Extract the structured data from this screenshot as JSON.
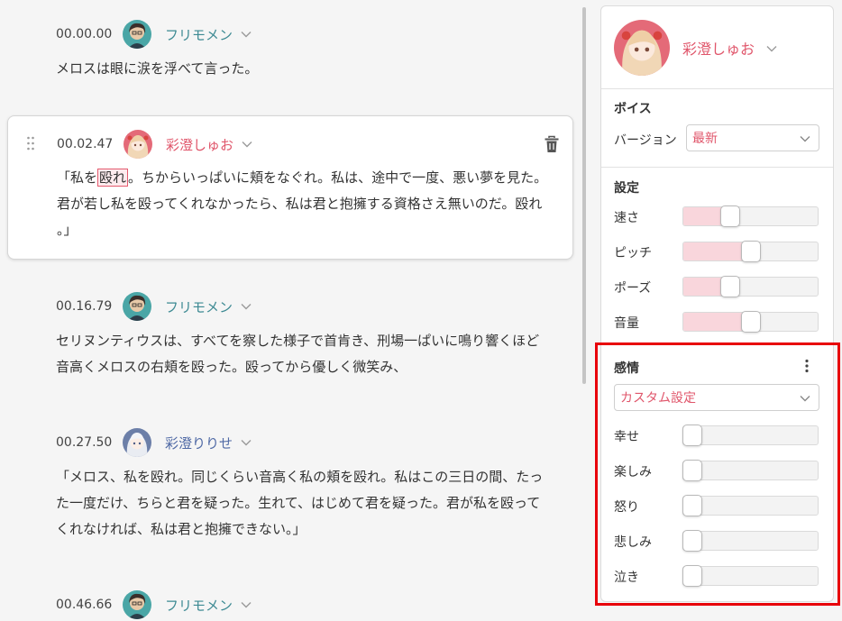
{
  "script": {
    "entries": [
      {
        "time": "00.00.00",
        "speaker": "フリモメン",
        "color": "teal",
        "lines": [
          "メロスは眼に涙を浮べて言った。"
        ]
      },
      {
        "time": "00.02.47",
        "speaker": "彩澄しゅお",
        "color": "pink",
        "selected": true,
        "line1_before": "「私を",
        "line1_highlight": "殴れ",
        "line1_after": "。ちからいっぱいに頬をなぐれ。私は、途中で一度、悪い夢を見た。",
        "line2": "君が若し私を殴ってくれなかったら、私は君と抱擁する資格さえ無いのだ。殴れ",
        "line3": "。」"
      },
      {
        "time": "00.16.79",
        "speaker": "フリモメン",
        "color": "teal",
        "lines": [
          "セリヌンティウスは、すべてを察した様子で首肯き、刑場一ぱいに鳴り響くほど",
          "音高くメロスの右頬を殴った。殴ってから優しく微笑み、"
        ]
      },
      {
        "time": "00.27.50",
        "speaker": "彩澄りりせ",
        "color": "blue",
        "lines": [
          "「メロス、私を殴れ。同じくらい音高く私の頬を殴れ。私はこの三日の間、たっ",
          "た一度だけ、ちらと君を疑った。生れて、はじめて君を疑った。君が私を殴って",
          "くれなければ、私は君と抱擁できない。」"
        ]
      },
      {
        "time": "00.46.66",
        "speaker": "フリモメン",
        "color": "teal",
        "lines": []
      }
    ]
  },
  "panel": {
    "character": "彩澄しゅお",
    "voice": {
      "title": "ボイス",
      "version_label": "バージョン",
      "version_value": "最新"
    },
    "settings": {
      "title": "設定",
      "sliders": [
        {
          "label": "速さ",
          "value": 0.35
        },
        {
          "label": "ピッチ",
          "value": 0.5
        },
        {
          "label": "ポーズ",
          "value": 0.35
        },
        {
          "label": "音量",
          "value": 0.5
        }
      ]
    },
    "emotion": {
      "title": "感情",
      "preset": "カスタム設定",
      "sliders": [
        {
          "label": "幸せ",
          "value": 0
        },
        {
          "label": "楽しみ",
          "value": 0
        },
        {
          "label": "怒り",
          "value": 0
        },
        {
          "label": "悲しみ",
          "value": 0
        },
        {
          "label": "泣き",
          "value": 0
        }
      ]
    }
  },
  "colors": {
    "teal": "#3d8a93",
    "pink": "#e0566b",
    "blue": "#4f69a5",
    "highlight_box": "#e8000a"
  }
}
